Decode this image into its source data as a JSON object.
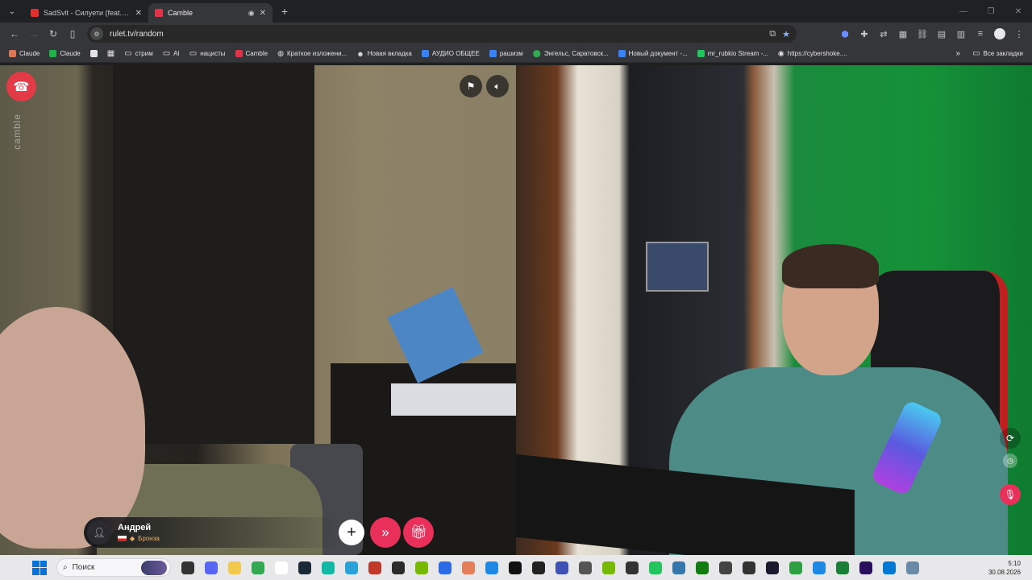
{
  "browser": {
    "tabs": [
      {
        "title": "SadSvit - Силуети (feat. СТРУКТУРА)",
        "favicon_color": "#e03030",
        "active": false
      },
      {
        "title": "Camble",
        "favicon_color": "#e0344a",
        "active": true
      }
    ],
    "new_tab_icon": "plus-icon",
    "address": "rulet.tv/random",
    "bookmarks": [
      {
        "label": "Claude",
        "icon_color": "#d97757"
      },
      {
        "label": "Claude",
        "icon_color": "#22b24c"
      },
      {
        "label": "",
        "icon_color": "#e3e3e3"
      },
      {
        "label": "",
        "icon_color": "#c4c7c5"
      },
      {
        "label": "стрим",
        "icon_color": "folder"
      },
      {
        "label": "AI",
        "icon_color": "folder"
      },
      {
        "label": "нацисты",
        "icon_color": "folder"
      },
      {
        "label": "Camble",
        "icon_color": "#e0344a"
      },
      {
        "label": "Краткое изложени...",
        "icon_color": "#c4c7c5"
      },
      {
        "label": "Новая вкладка",
        "icon_color": "#c4c7c5"
      },
      {
        "label": "АУДИО ОБЩЕЕ",
        "icon_color": "#3b82f6"
      },
      {
        "label": "рашизм",
        "icon_color": "#3b82f6"
      },
      {
        "label": "Энгельс, Саратовск...",
        "icon_color": "#34a853"
      },
      {
        "label": "Новый документ -...",
        "icon_color": "#3b82f6"
      },
      {
        "label": "mr_rubkio Stream -...",
        "icon_color": "#22c55e"
      },
      {
        "label": "https://cybershoke....",
        "icon_color": "#6b7280"
      }
    ],
    "all_bookmarks_label": "Все закладки"
  },
  "call": {
    "watermark": "camble",
    "partner_name": "Андрей",
    "partner_rank": "Бронза",
    "colors": {
      "hangup": "#e23a46",
      "accent": "#e8305a"
    }
  },
  "taskbar": {
    "search_placeholder": "Поиск",
    "time": "5:10",
    "date": "30.08.2026",
    "apps": [
      {
        "name": "task-view",
        "color": "#333333"
      },
      {
        "name": "discord",
        "color": "#5865f2"
      },
      {
        "name": "file-explorer",
        "color": "#f2c94c"
      },
      {
        "name": "chrome",
        "color": "#34a853"
      },
      {
        "name": "notepad",
        "color": "#ffffff"
      },
      {
        "name": "steam",
        "color": "#1b2838"
      },
      {
        "name": "app-cyan",
        "color": "#14b8a6"
      },
      {
        "name": "telegram",
        "color": "#2aa1d8"
      },
      {
        "name": "app-db",
        "color": "#c0392b"
      },
      {
        "name": "terminal",
        "color": "#2b2b2b"
      },
      {
        "name": "nvidia",
        "color": "#76b900"
      },
      {
        "name": "arc",
        "color": "#2d6be4"
      },
      {
        "name": "app-star",
        "color": "#e67e5a"
      },
      {
        "name": "app-check",
        "color": "#1e88e5"
      },
      {
        "name": "capcut",
        "color": "#111111"
      },
      {
        "name": "openai",
        "color": "#222222"
      },
      {
        "name": "app-diamond",
        "color": "#3f51b5"
      },
      {
        "name": "app-list",
        "color": "#555555"
      },
      {
        "name": "nvidia-2",
        "color": "#76b900"
      },
      {
        "name": "obs",
        "color": "#333333"
      },
      {
        "name": "app-green",
        "color": "#22c55e"
      },
      {
        "name": "python",
        "color": "#3776ab"
      },
      {
        "name": "xbox",
        "color": "#107c10"
      },
      {
        "name": "app-knot",
        "color": "#444444"
      },
      {
        "name": "app-dot",
        "color": "#333333"
      },
      {
        "name": "app-x",
        "color": "#1a1a2e"
      },
      {
        "name": "app-green-2",
        "color": "#2ea043"
      },
      {
        "name": "app-car",
        "color": "#1e88e5"
      },
      {
        "name": "app-bars",
        "color": "#1a7f37"
      },
      {
        "name": "premiere",
        "color": "#2a0f5c"
      },
      {
        "name": "app-grid",
        "color": "#0078d4"
      },
      {
        "name": "app-photo",
        "color": "#6b8aa8"
      }
    ]
  }
}
